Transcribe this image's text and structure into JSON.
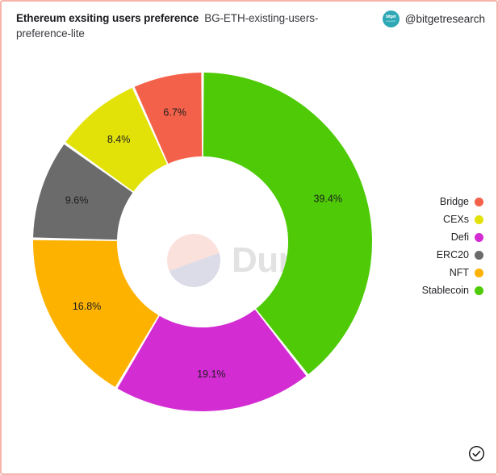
{
  "header": {
    "title": "Ethereum exsiting users preference",
    "subtitle": "BG-ETH-existing-users-preference-lite",
    "account_handle": "@bitgetresearch",
    "avatar_mark": "bitget",
    "avatar_submark": "research"
  },
  "watermark": {
    "text": "Dune",
    "logo_icon": "dune-logo-icon"
  },
  "footer": {
    "verified_icon": "check-circle-icon"
  },
  "legend": {
    "items": [
      {
        "label": "Bridge",
        "color": "#f4614a"
      },
      {
        "label": "CEXs",
        "color": "#e2e209"
      },
      {
        "label": "Defi",
        "color": "#d32cd3"
      },
      {
        "label": "ERC20",
        "color": "#6b6b6b"
      },
      {
        "label": "NFT",
        "color": "#fdb200"
      },
      {
        "label": "Stablecoin",
        "color": "#4ecb06"
      }
    ]
  },
  "chart_data": {
    "type": "pie",
    "title": "Ethereum exsiting users preference",
    "subtitle": "BG-ETH-existing-users-preference-lite",
    "donut": true,
    "inner_radius_ratio": 0.505,
    "start_angle_deg": 0,
    "direction": "clockwise",
    "legend_position": "right",
    "grid": false,
    "xlabel": "",
    "ylabel": "",
    "labels": [
      "Stablecoin",
      "Defi",
      "NFT",
      "ERC20",
      "CEXs",
      "Bridge"
    ],
    "values": [
      39.4,
      19.1,
      16.8,
      9.6,
      8.4,
      6.7
    ],
    "colors": [
      "#4ecb06",
      "#d32cd3",
      "#fdb200",
      "#6b6b6b",
      "#e2e209",
      "#f4614a"
    ],
    "value_labels": [
      "39.4%",
      "19.1%",
      "16.8%",
      "9.6%",
      "8.4%",
      "6.7%"
    ],
    "unit": "%",
    "total": 100.0
  }
}
